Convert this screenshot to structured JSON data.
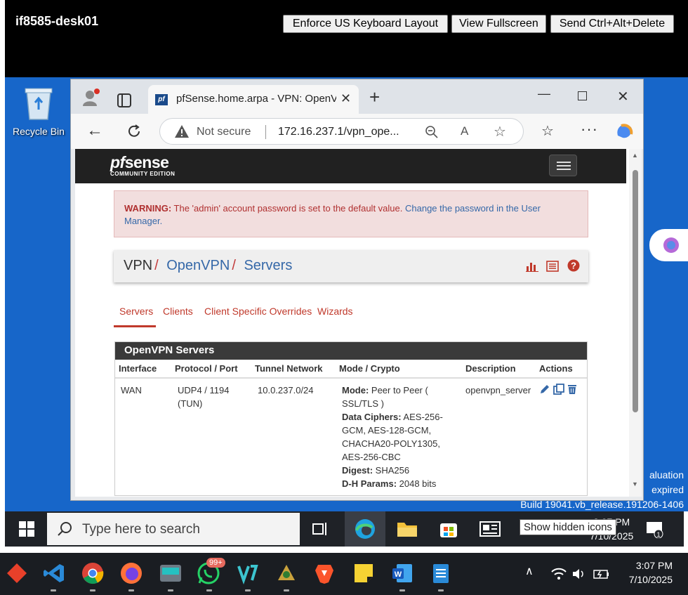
{
  "kvm": {
    "title": "if8585-desk01",
    "buttons": [
      "Enforce US Keyboard Layout",
      "View Fullscreen",
      "Send Ctrl+Alt+Delete"
    ]
  },
  "desktop": {
    "recycle_label": "Recycle Bin",
    "eval_lines": [
      "aluation",
      "expired",
      "Build 19041.vb_release.191206-1406"
    ]
  },
  "browser": {
    "tab_title": "pfSense.home.arpa - VPN: OpenVPN: Servers",
    "not_secure": "Not secure",
    "url": "172.16.237.1/vpn_ope..."
  },
  "pfsense": {
    "logo_main_pf": "pf",
    "logo_main_rest": "sense",
    "logo_sub": "COMMUNITY EDITION",
    "warning_label": "WARNING:",
    "warning_text": " The 'admin' account password is set to the default value. ",
    "warning_link": "Change the password in the User Manager.",
    "breadcrumb": [
      "VPN",
      "OpenVPN",
      "Servers"
    ],
    "breadcrumb_sep": "/",
    "tabs": [
      "Servers",
      "Clients",
      "Client Specific Overrides",
      "Wizards"
    ],
    "panel_title": "OpenVPN Servers",
    "columns": [
      "Interface",
      "Protocol / Port",
      "Tunnel Network",
      "Mode / Crypto",
      "Description",
      "Actions"
    ],
    "row": {
      "interface": "WAN",
      "protocol": "UDP4 / 1194 (TUN)",
      "tunnel": "10.0.237.0/24",
      "mode_label": "Mode:",
      "mode_value": " Peer to Peer ( SSL/TLS )",
      "ciphers_label": "Data Ciphers:",
      "ciphers_value": " AES-256-GCM, AES-128-GCM, CHACHA20-POLY1305, AES-256-CBC",
      "digest_label": "Digest:",
      "digest_value": " SHA256",
      "dh_label": "D-H Params:",
      "dh_value": " 2048 bits",
      "description": "openvpn_server"
    }
  },
  "vm_taskbar": {
    "search_placeholder": "Type here to search",
    "tooltip": "Show hidden icons",
    "clock_time": "3:07 PM",
    "clock_date": "7/10/2025"
  },
  "host_taskbar": {
    "badge": "99+",
    "clock_time": "3:07 PM",
    "clock_date": "7/10/2025"
  }
}
